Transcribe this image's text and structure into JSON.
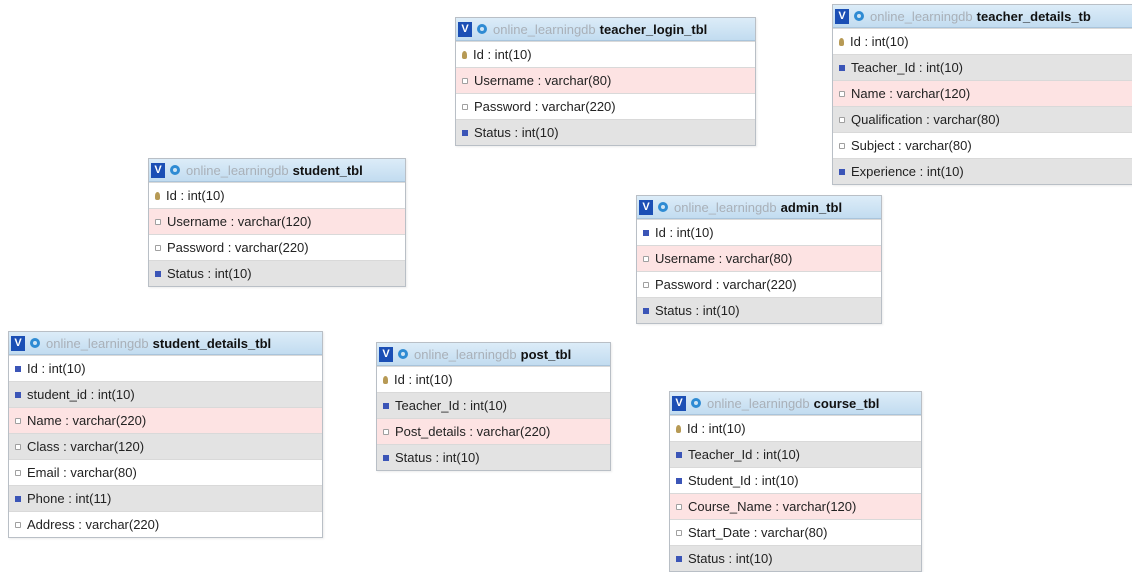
{
  "db_name": "online_learningdb",
  "toggle_label": "V",
  "tables": [
    {
      "name": "teacher_login_tbl",
      "rows": [
        {
          "text": "Id : int(10)",
          "icon": "key",
          "bg": "pk"
        },
        {
          "text": "Username : varchar(80)",
          "icon": "txt",
          "bg": "str"
        },
        {
          "text": "Password : varchar(220)",
          "icon": "txt",
          "bg": "plain"
        },
        {
          "text": "Status : int(10)",
          "icon": "num",
          "bg": "fk"
        }
      ]
    },
    {
      "name": "teacher_details_tb",
      "rows": [
        {
          "text": "Id : int(10)",
          "icon": "key",
          "bg": "pk"
        },
        {
          "text": "Teacher_Id : int(10)",
          "icon": "num",
          "bg": "fk"
        },
        {
          "text": "Name : varchar(120)",
          "icon": "txt",
          "bg": "str"
        },
        {
          "text": "Qualification : varchar(80)",
          "icon": "txt",
          "bg": "fk"
        },
        {
          "text": "Subject : varchar(80)",
          "icon": "txt",
          "bg": "plain"
        },
        {
          "text": "Experience : int(10)",
          "icon": "num",
          "bg": "fk"
        }
      ]
    },
    {
      "name": "student_tbl",
      "rows": [
        {
          "text": "Id : int(10)",
          "icon": "key",
          "bg": "pk"
        },
        {
          "text": "Username : varchar(120)",
          "icon": "txt",
          "bg": "str"
        },
        {
          "text": "Password : varchar(220)",
          "icon": "txt",
          "bg": "plain"
        },
        {
          "text": "Status : int(10)",
          "icon": "num",
          "bg": "fk"
        }
      ]
    },
    {
      "name": "admin_tbl",
      "rows": [
        {
          "text": "Id : int(10)",
          "icon": "num",
          "bg": "pk"
        },
        {
          "text": "Username : varchar(80)",
          "icon": "txt",
          "bg": "str"
        },
        {
          "text": "Password : varchar(220)",
          "icon": "txt",
          "bg": "plain"
        },
        {
          "text": "Status : int(10)",
          "icon": "num",
          "bg": "fk"
        }
      ]
    },
    {
      "name": "student_details_tbl",
      "rows": [
        {
          "text": "Id : int(10)",
          "icon": "num",
          "bg": "pk"
        },
        {
          "text": "student_id : int(10)",
          "icon": "num",
          "bg": "fk"
        },
        {
          "text": "Name : varchar(220)",
          "icon": "txt",
          "bg": "str"
        },
        {
          "text": "Class : varchar(120)",
          "icon": "txt",
          "bg": "fk"
        },
        {
          "text": "Email : varchar(80)",
          "icon": "txt",
          "bg": "plain"
        },
        {
          "text": "Phone : int(11)",
          "icon": "num",
          "bg": "fk"
        },
        {
          "text": "Address : varchar(220)",
          "icon": "txt",
          "bg": "plain"
        }
      ]
    },
    {
      "name": "post_tbl",
      "rows": [
        {
          "text": "Id : int(10)",
          "icon": "key",
          "bg": "pk"
        },
        {
          "text": "Teacher_Id : int(10)",
          "icon": "num",
          "bg": "fk"
        },
        {
          "text": "Post_details : varchar(220)",
          "icon": "txt",
          "bg": "str"
        },
        {
          "text": "Status : int(10)",
          "icon": "num",
          "bg": "fk"
        }
      ]
    },
    {
      "name": "course_tbl",
      "rows": [
        {
          "text": "Id : int(10)",
          "icon": "key",
          "bg": "pk"
        },
        {
          "text": "Teacher_Id : int(10)",
          "icon": "num",
          "bg": "fk"
        },
        {
          "text": "Student_Id : int(10)",
          "icon": "num",
          "bg": "plain"
        },
        {
          "text": "Course_Name : varchar(120)",
          "icon": "txt",
          "bg": "str"
        },
        {
          "text": "Start_Date : varchar(80)",
          "icon": "txt",
          "bg": "plain"
        },
        {
          "text": "Status : int(10)",
          "icon": "num",
          "bg": "fk"
        }
      ]
    }
  ]
}
